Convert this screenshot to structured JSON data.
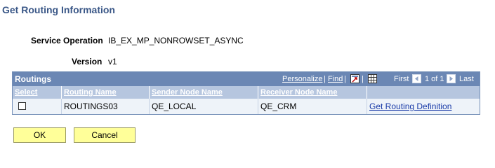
{
  "page": {
    "title": "Get Routing Information"
  },
  "fields": {
    "service_operation_label": "Service Operation",
    "service_operation_value": "IB_EX_MP_NONROWSET_ASYNC",
    "version_label": "Version",
    "version_value": "v1"
  },
  "grid": {
    "title": "Routings",
    "personalize": "Personalize",
    "find": "Find",
    "separator": "|",
    "first": "First",
    "position": "1 of 1",
    "last": "Last",
    "columns": [
      "Select",
      "Routing Name",
      "Sender Node Name",
      "Receiver Node Name"
    ],
    "rows": [
      {
        "selected": false,
        "routing_name": "ROUTINGS03",
        "sender": "QE_LOCAL",
        "receiver": "QE_CRM",
        "action": "Get Routing Definition"
      }
    ]
  },
  "buttons": {
    "ok": "OK",
    "cancel": "Cancel"
  },
  "colors": {
    "title": "#3a5787",
    "header": "#6b87b4",
    "column_header": "#b6c6df",
    "button": "#ffff99",
    "link": "#1a3ba8"
  },
  "icons": [
    "download-icon",
    "view-all-icon",
    "prev-arrow-icon",
    "next-arrow-icon"
  ]
}
